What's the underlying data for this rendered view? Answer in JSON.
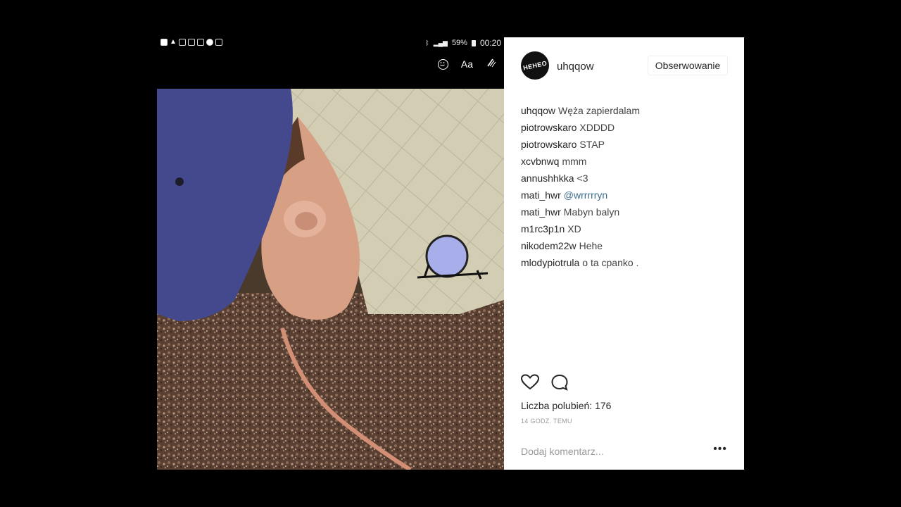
{
  "phone_status": {
    "battery": "59%",
    "time": "00:20",
    "app_icons": [
      "youtube-icon",
      "warning-icon",
      "instagram-icon",
      "instagram-icon",
      "instagram-icon",
      "messenger-icon",
      "instagram-icon"
    ]
  },
  "story_tools": {
    "sticker_icon": "smile-icon",
    "text_tool": "Aa",
    "draw_icon": "brush-icon"
  },
  "post": {
    "username": "uhqqow",
    "avatar_text": "HEHEO",
    "follow_label": "Obserwowanie",
    "comments": [
      {
        "user": "uhqqow",
        "text": "Węża zapierdalam"
      },
      {
        "user": "piotrowskaro",
        "text": "XDDDD"
      },
      {
        "user": "piotrowskaro",
        "text": "STAP"
      },
      {
        "user": "xcvbnwq",
        "text": "mmm"
      },
      {
        "user": "annushhkka",
        "text": "<3"
      },
      {
        "user": "mati_hwr",
        "text": "@wrrrrryn",
        "is_mention": true
      },
      {
        "user": "mati_hwr",
        "text": "Mabyn balyn"
      },
      {
        "user": "m1rc3p1n",
        "text": "XD"
      },
      {
        "user": "nikodem22w",
        "text": "Hehe"
      },
      {
        "user": "mlodypiotrula",
        "text": "o ta cpanko ."
      }
    ],
    "likes_label": "Liczba polubień: 176",
    "time_ago": "14 GODZ. TEMU",
    "comment_placeholder": "Dodaj komentarz...",
    "more_label": "•••"
  },
  "colors": {
    "mention": "#3d6c8e",
    "text": "#262626",
    "muted": "#999999"
  }
}
